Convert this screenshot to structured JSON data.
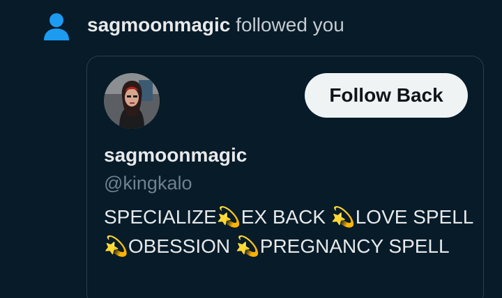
{
  "notification": {
    "icon": "person-icon",
    "username": "sagmoonmagic",
    "action": "followed you"
  },
  "card": {
    "avatar": "profile-photo",
    "follow_button_label": "Follow Back",
    "display_name": "sagmoonmagic",
    "handle": "@kingkalo",
    "bio": "SPECIALIZE💫EX BACK 💫LOVE SPELL 💫OBESSION 💫PREGNANCY SPELL"
  },
  "colors": {
    "background": "#071b29",
    "accent_blue": "#1d9bf0",
    "button_bg": "#eff3f4",
    "text_primary": "#e7e9ea",
    "text_secondary": "#71818e",
    "border": "#2f3d49"
  }
}
